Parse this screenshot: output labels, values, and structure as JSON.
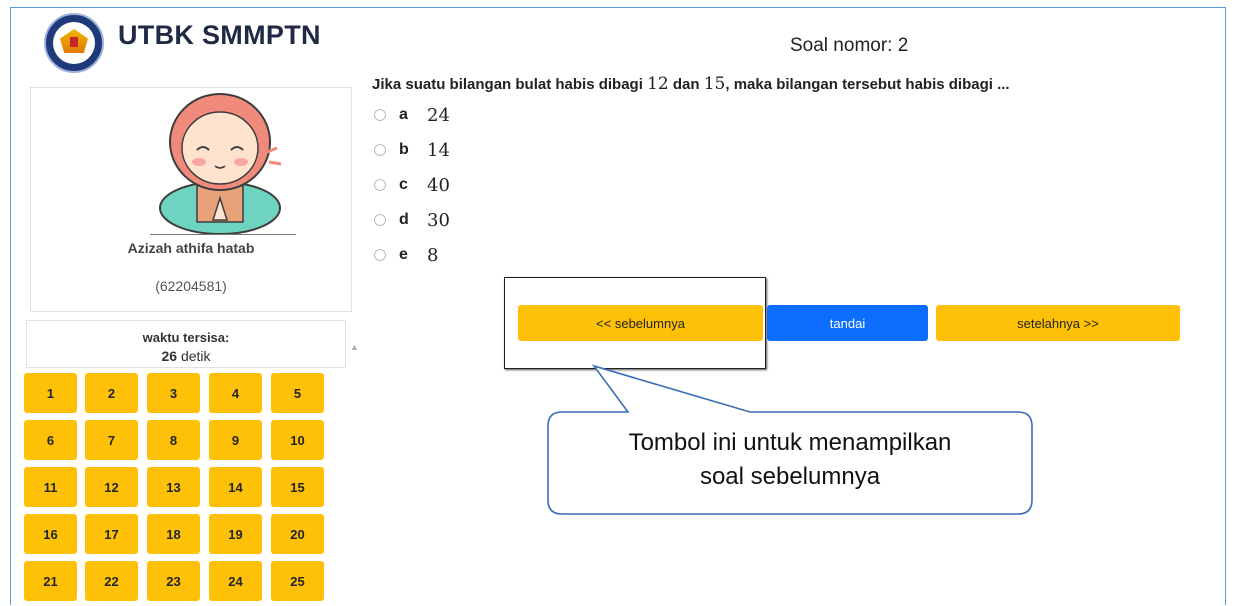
{
  "app": {
    "title": "UTBK SMMPTN"
  },
  "student": {
    "name": "Azizah athifa hatab",
    "id": "(62204581)"
  },
  "timer": {
    "label": "waktu tersisa:",
    "value": "26",
    "unit": "detik"
  },
  "question_nav": {
    "numbers": [
      "1",
      "2",
      "3",
      "4",
      "5",
      "6",
      "7",
      "8",
      "9",
      "10",
      "11",
      "12",
      "13",
      "14",
      "15",
      "16",
      "17",
      "18",
      "19",
      "20",
      "21",
      "22",
      "23",
      "24",
      "25"
    ]
  },
  "question": {
    "header": "Soal nomor: 2",
    "text_part1": "Jika suatu bilangan bulat habis dibagi",
    "num1": "12",
    "text_part2": "dan",
    "num2": "15",
    "text_part3": ", maka bilangan tersebut habis dibagi ..."
  },
  "options": [
    {
      "letter": "a",
      "value": "24"
    },
    {
      "letter": "b",
      "value": "14"
    },
    {
      "letter": "c",
      "value": "40"
    },
    {
      "letter": "d",
      "value": "30"
    },
    {
      "letter": "e",
      "value": "8"
    }
  ],
  "buttons": {
    "prev": "<< sebelumnya",
    "mark": "tandai",
    "next": "setelahnya >>"
  },
  "callout": {
    "line1": "Tombol ini untuk menampilkan",
    "line2": "soal sebelumnya"
  },
  "colors": {
    "nav_yellow": "#ffc107",
    "mark_blue": "#0d6efd",
    "callout_border": "#3a6db5"
  }
}
